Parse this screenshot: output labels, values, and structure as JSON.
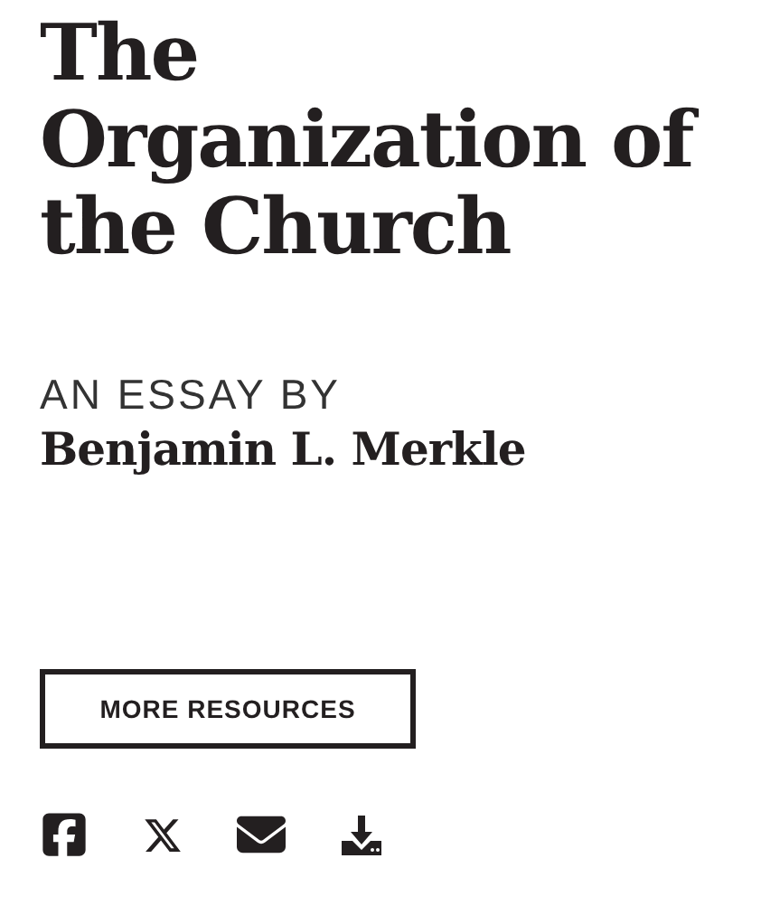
{
  "title": "The Organization of the Church",
  "byline": "AN ESSAY BY",
  "author": "Benjamin L. Merkle",
  "button": "MORE RESOURCES",
  "share_icons": [
    {
      "kind": "facebook"
    },
    {
      "kind": "x"
    },
    {
      "kind": "email"
    },
    {
      "kind": "download"
    }
  ]
}
